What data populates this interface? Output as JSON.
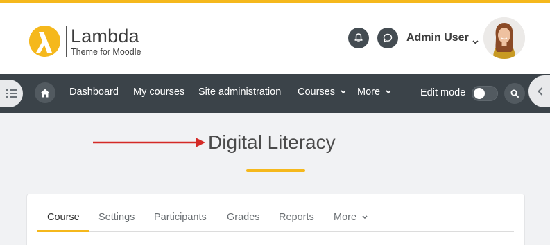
{
  "brand": {
    "name": "Lambda",
    "tagline": "Theme for Moodle",
    "accent_color": "#f5b81c",
    "nav_color": "#3b4349"
  },
  "header": {
    "notifications_icon": "bell-icon",
    "messages_icon": "chat-bubble-icon",
    "user_name": "Admin User",
    "user_menu_icon": "chevron-down-icon"
  },
  "nav": {
    "drawer_icon": "list-icon",
    "home_icon": "home-icon",
    "items": [
      {
        "label": "Dashboard"
      },
      {
        "label": "My courses"
      },
      {
        "label": "Site administration"
      },
      {
        "label": "Courses",
        "has_dropdown": true
      },
      {
        "label": "More",
        "has_dropdown": true
      }
    ],
    "edit_mode_label": "Edit mode",
    "edit_mode_on": false,
    "search_icon": "search-icon",
    "right_drawer_icon": "chevron-left-icon"
  },
  "page": {
    "title": "Digital Literacy"
  },
  "course_tabs": {
    "active_index": 0,
    "items": [
      {
        "label": "Course"
      },
      {
        "label": "Settings"
      },
      {
        "label": "Participants"
      },
      {
        "label": "Grades"
      },
      {
        "label": "Reports"
      },
      {
        "label": "More",
        "has_dropdown": true
      }
    ]
  }
}
